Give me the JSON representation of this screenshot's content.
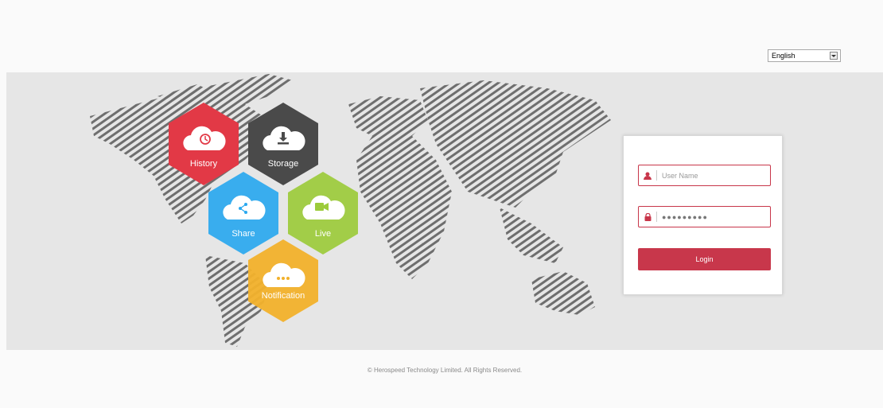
{
  "header": {
    "language": {
      "selected": "English"
    }
  },
  "tiles": [
    {
      "label": "History",
      "icon": "history-icon",
      "color": "#e23946"
    },
    {
      "label": "Storage",
      "icon": "download-icon",
      "color": "#4a4a4a"
    },
    {
      "label": "Share",
      "icon": "share-icon",
      "color": "#2aa8ef"
    },
    {
      "label": "Live",
      "icon": "camera-icon",
      "color": "#9ccb3b"
    },
    {
      "label": "Notification",
      "icon": "message-icon",
      "color": "#f2b12b"
    }
  ],
  "login": {
    "username_placeholder": "User Name",
    "password_value": "●●●●●●●●●",
    "button_label": "Login",
    "accent_color": "#c8374b"
  },
  "footer": {
    "copyright": "© Herospeed Technology Limited.  All Rights Reserved."
  }
}
